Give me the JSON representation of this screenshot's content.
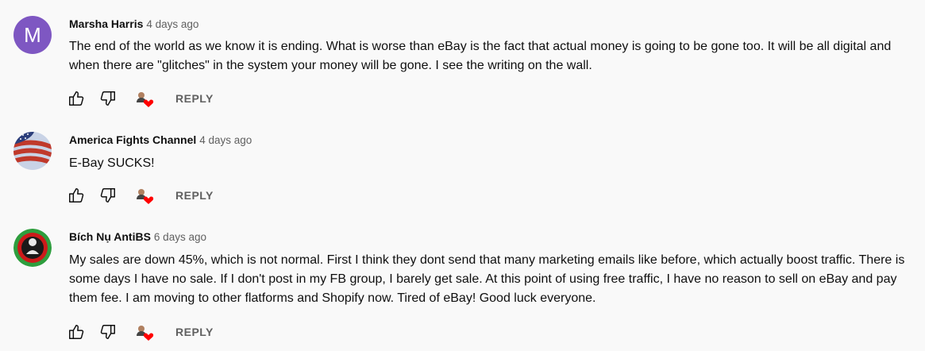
{
  "comments": [
    {
      "author": "Marsha Harris",
      "time": "4 days ago",
      "avatar": "M",
      "avatar_color": "#7e57c2",
      "text": "The end of the world as we know it is ending. What is worse than eBay is the fact that actual money is going to be gone too. It will be all digital and when there are \"glitches\" in the system your money will be gone. I see the writing on the wall.",
      "reply_label": "REPLY"
    },
    {
      "author": "America Fights Channel",
      "time": "4 days ago",
      "avatar_icon": "american-flag-icon",
      "text": "E-Bay SUCKS!",
      "reply_label": "REPLY"
    },
    {
      "author": "Bích Nụ AntiBS",
      "time": "6 days ago",
      "avatar_icon": "green-red-logo-icon",
      "text": "My sales are down 45%, which is not normal. First I think they dont send that many marketing emails like before, which actually boost traffic. There is some days I have no sale. If I don't post in my FB group, I barely get sale. At this point of using free traffic, I have no reason to sell on eBay and pay them fee. I am moving to other flatforms and Shopify now. Tired of eBay! Good luck everyone.",
      "reply_label": "REPLY"
    }
  ],
  "icons": {
    "like": "thumb-up-icon",
    "dislike": "thumb-down-icon",
    "creator_heart": "creator-heart-icon"
  },
  "colors": {
    "background": "#f9f9f9",
    "heart": "#ff0000",
    "secondary_text": "#606060"
  }
}
